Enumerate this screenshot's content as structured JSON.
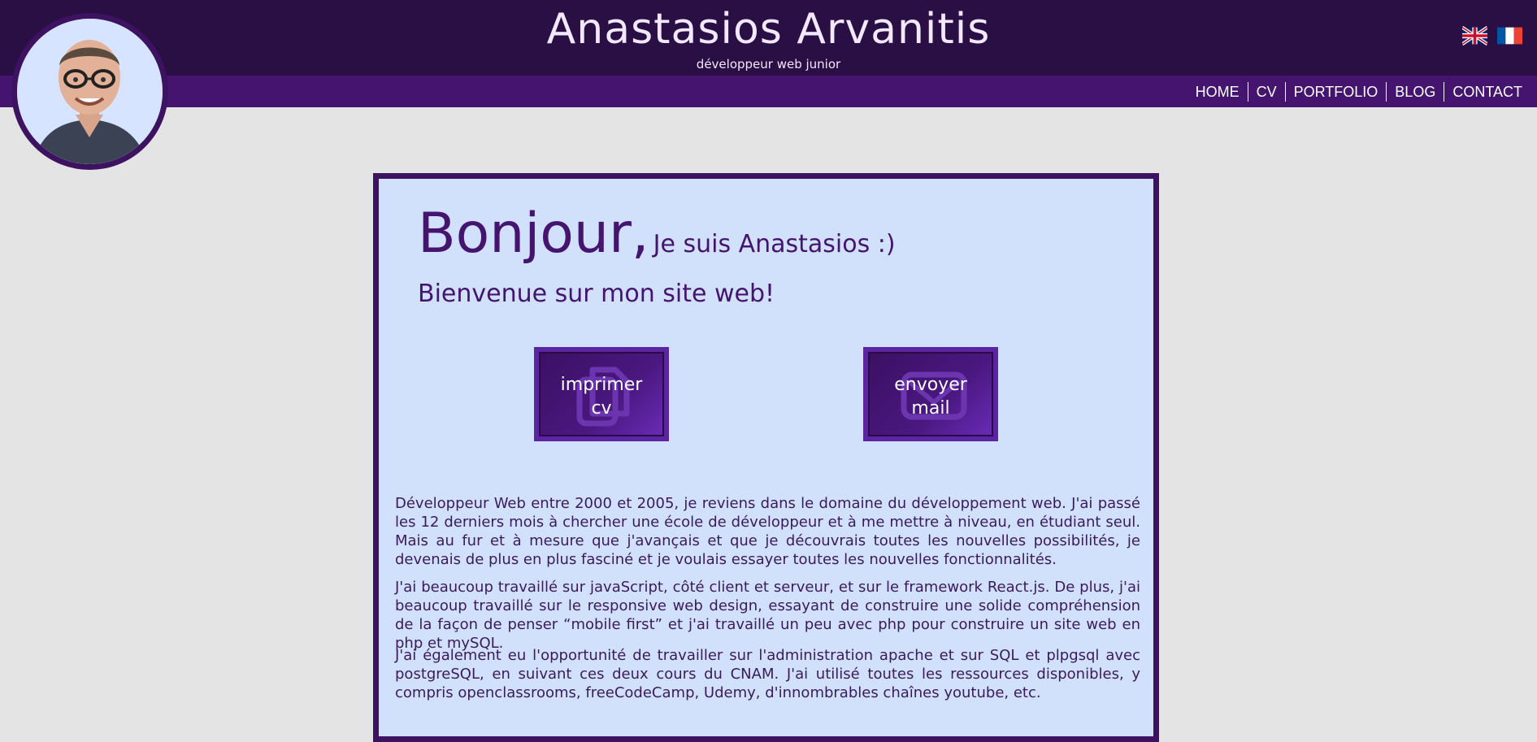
{
  "header": {
    "title": "Anastasios Arvanitis",
    "subtitle": "développeur web junior",
    "languages": [
      "English",
      "Français"
    ]
  },
  "nav": {
    "items": [
      "HOME",
      "CV",
      "PORTFOLIO",
      "BLOG",
      "CONTACT"
    ]
  },
  "main": {
    "greeting_big": "Bonjour,",
    "greeting_small": "Je suis Anastasios :)",
    "welcome": "Bienvenue sur mon site web!",
    "buttons": {
      "print_cv": {
        "line1": "imprimer",
        "line2": "cv",
        "icon": "copy-document-icon"
      },
      "send_mail": {
        "line1": "envoyer",
        "line2": "mail",
        "icon": "envelope-icon"
      }
    },
    "paragraphs": [
      "Développeur Web entre 2000 et 2005, je reviens dans le domaine du développement web. J'ai passé les 12 derniers mois à chercher une école de développeur et à me mettre à niveau, en étudiant seul. Mais au fur et à mesure que j'avançais et que je découvrais toutes les nouvelles possibilités, je devenais de plus en plus fasciné et je voulais essayer toutes les nouvelles fonctionnalités.",
      "J'ai beaucoup travaillé sur javaScript, côté client et serveur, et sur le framework React.js. De plus, j'ai beaucoup travaillé sur le responsive web design, essayant de construire une solide compréhension de la façon de penser “mobile first” et j'ai travaillé un peu avec php pour construire un site web en php et mySQL.",
      "J'ai également eu l'opportunité de travailler sur l'administration apache et sur SQL et plpgsql avec postgreSQL, en suivant ces deux cours du CNAM. J'ai utilisé toutes les ressources disponibles, y compris openclassrooms, freeCodeCamp, Udemy, d'innombrables chaînes youtube, etc."
    ]
  },
  "colors": {
    "header_dark": "#2a0f45",
    "nav_purple": "#44146e",
    "card_bg": "#d1e1fc",
    "page_bg": "#e4e4e4",
    "accent_text": "#44146e"
  }
}
